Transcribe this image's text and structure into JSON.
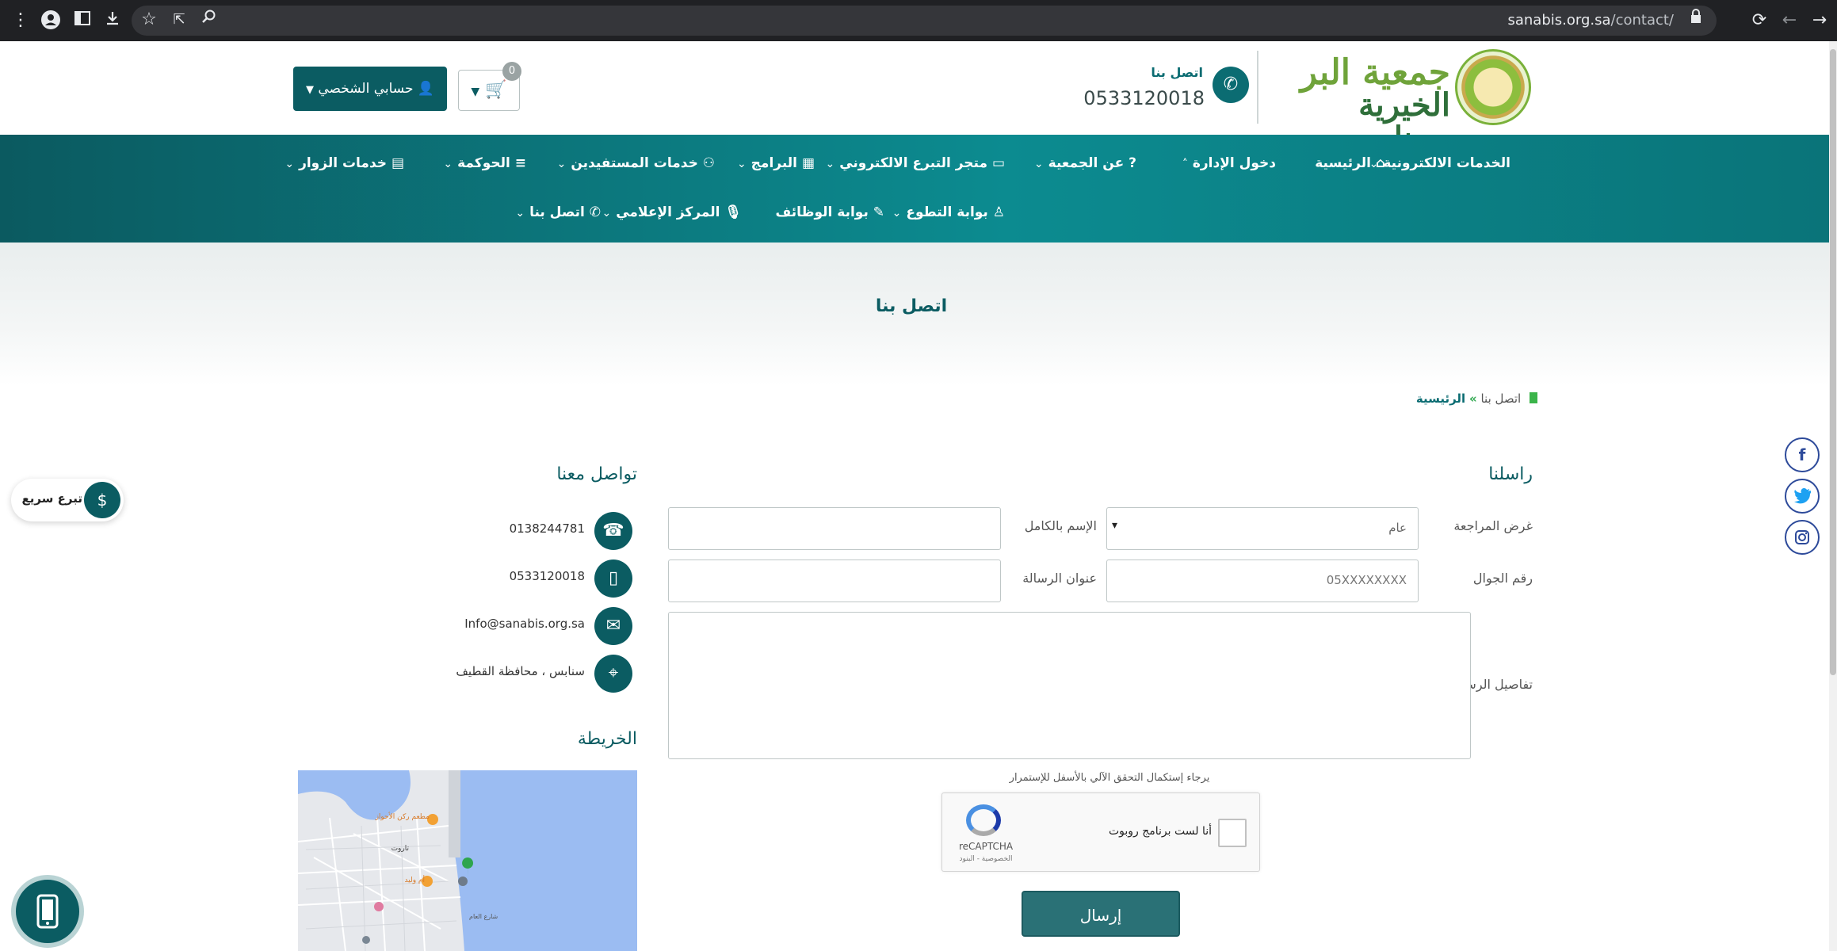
{
  "browser": {
    "url_domain": "sanabis.org.sa",
    "url_path": "/contact/"
  },
  "header": {
    "logo_line1": "جمعية البر",
    "logo_line2": "الخيرية بسنابس",
    "contact_label": "اتصل بنا",
    "contact_phone": "0533120018",
    "cart_count": "0",
    "account_label": "حسابي الشخصي"
  },
  "nav": {
    "row1": [
      "الخدمات الالكترونية",
      "الرئيسية",
      "دخول الإدارة",
      "عن الجمعية",
      "متجر التبرع الالكتروني",
      "البرامج",
      "خدمات المستفيدين",
      "الحوكمة",
      "خدمات الزوار"
    ],
    "row2": [
      "بوابة التطوع",
      "بوابة الوظائف",
      "المركز الإعلامي",
      "اتصل بنا"
    ]
  },
  "page": {
    "title": "اتصل بنا",
    "breadcrumb_home": "الرئيسية",
    "breadcrumb_sep": "»",
    "breadcrumb_current": "اتصل بنا"
  },
  "form": {
    "section_title": "راسلنا",
    "purpose_label": "غرض المراجعة",
    "purpose_value": "عام",
    "fullname_label": "الإسم بالكامل",
    "mobile_label": "رقم الجوال",
    "mobile_placeholder": "05XXXXXXXX",
    "subject_label": "عنوان الرسالة",
    "details_label": "تفاصيل الرسالة",
    "captcha_note": "يرجاء إستكمال التحقق الآلي بالأسفل للإستمرار",
    "captcha_text": "أنا لست برنامج روبوت",
    "captcha_brand": "reCAPTCHA",
    "captcha_links": "الخصوصية - البنود",
    "submit_label": "إرسال"
  },
  "contact_info": {
    "section_title": "تواصل معنا",
    "landline": "0138244781",
    "mobile": "0533120018",
    "email": "Info@sanabis.org.sa",
    "address": "سنابس ، محافظة القطيف",
    "map_title": "الخريطة"
  },
  "map_labels": {
    "place1": "مطعم ركن الأحواز",
    "place2": "تاروت",
    "place3": "أم وليد",
    "place4": "شارع العام"
  },
  "floating": {
    "quick_donate": "تبرع سريع"
  },
  "colors": {
    "primary": "#0b5c62",
    "nav_gradient_start": "#0b5a60",
    "nav_gradient_mid": "#0c8b90",
    "breadcrumb_marker": "#3bb44a",
    "social_border": "#2d4a9a"
  }
}
